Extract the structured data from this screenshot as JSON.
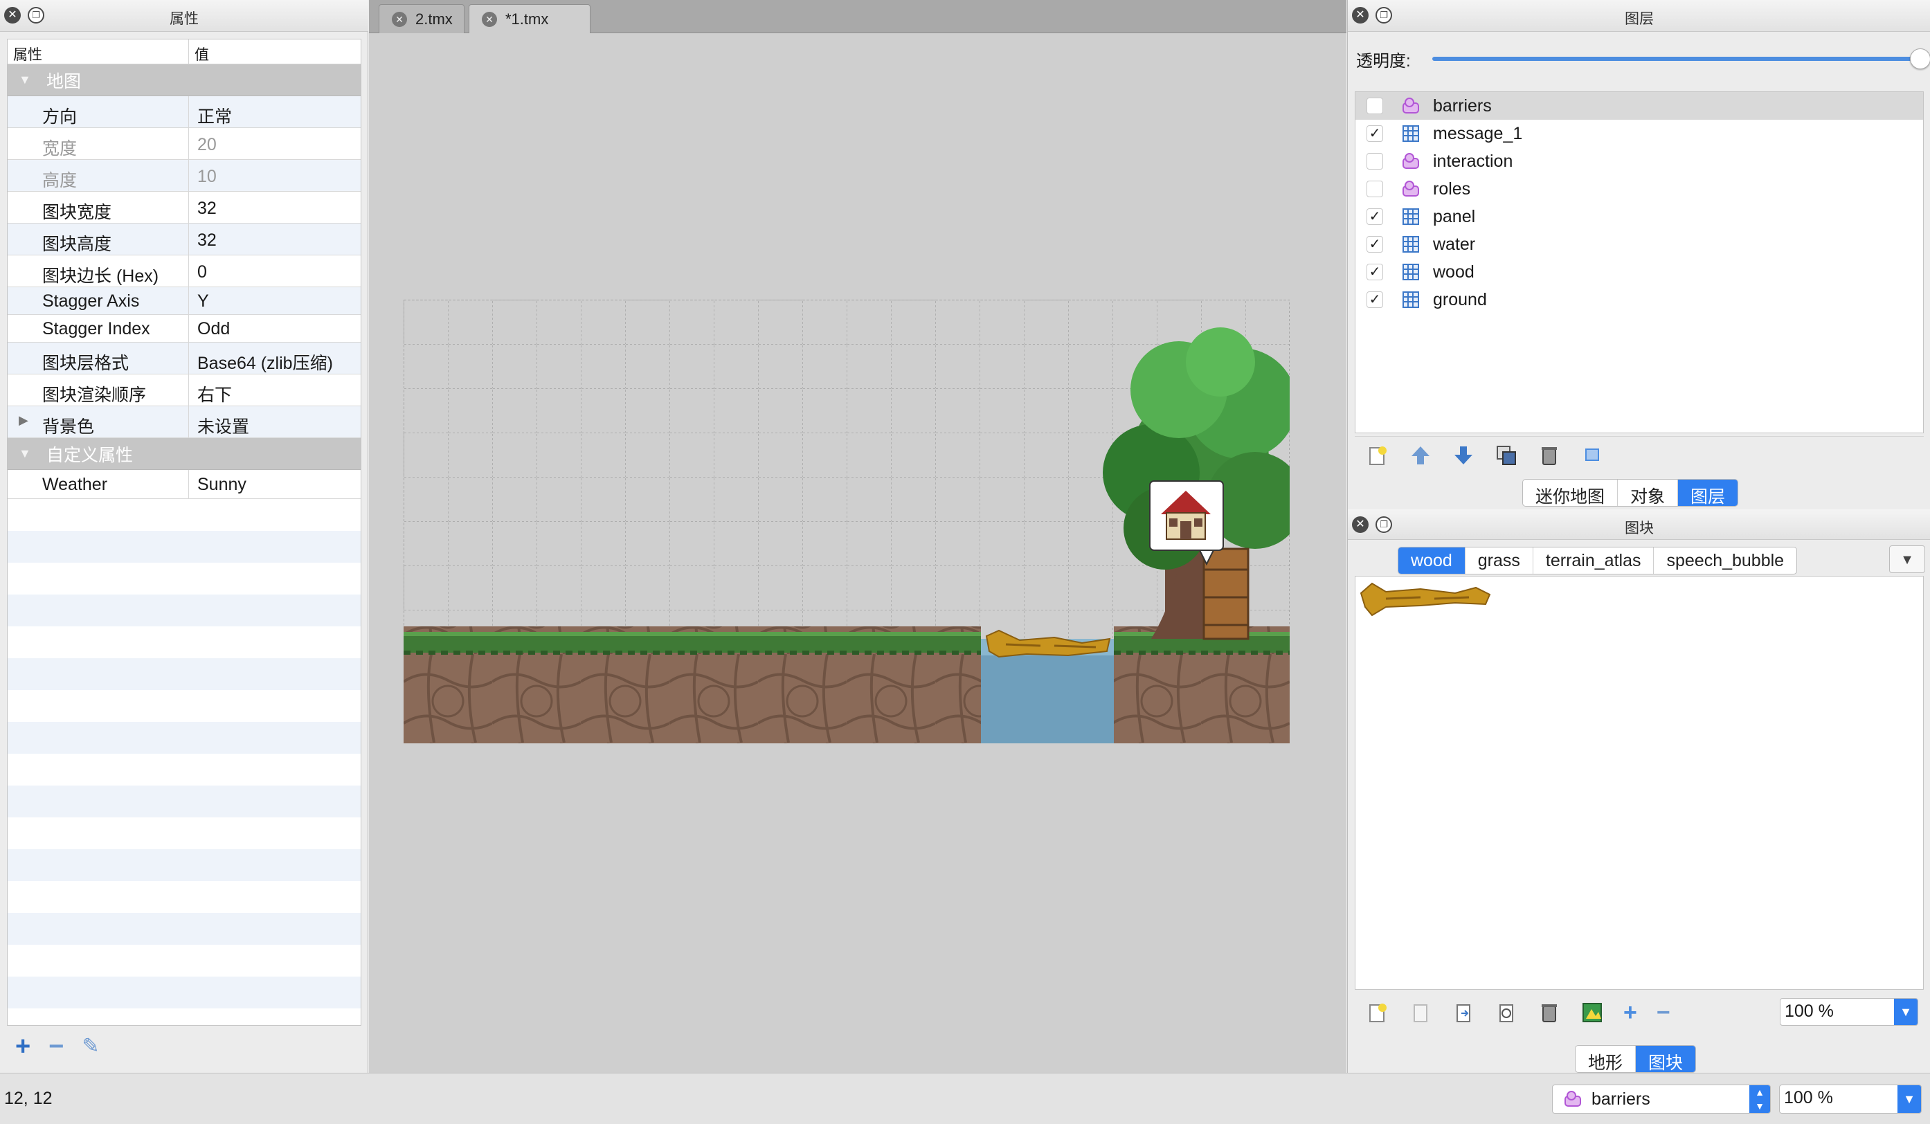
{
  "properties_panel": {
    "title": "属性",
    "columns": {
      "property": "属性",
      "value": "值"
    },
    "group_map": "地图",
    "rows": [
      {
        "key": "方向",
        "value": "正常"
      },
      {
        "key": "宽度",
        "value": "20"
      },
      {
        "key": "高度",
        "value": "10"
      },
      {
        "key": "图块宽度",
        "value": "32"
      },
      {
        "key": "图块高度",
        "value": "32"
      },
      {
        "key": "图块边长 (Hex)",
        "value": "0"
      },
      {
        "key": "Stagger Axis",
        "value": "Y"
      },
      {
        "key": "Stagger Index",
        "value": "Odd"
      },
      {
        "key": "图块层格式",
        "value": "Base64 (zlib压缩)"
      },
      {
        "key": "图块渲染顺序",
        "value": "右下"
      },
      {
        "key": "背景色",
        "value": "未设置"
      }
    ],
    "group_custom": "自定义属性",
    "custom_rows": [
      {
        "key": "Weather",
        "value": "Sunny"
      }
    ]
  },
  "editor": {
    "tabs": [
      {
        "label": "2.tmx"
      },
      {
        "label": "*1.tmx"
      }
    ]
  },
  "layers_panel": {
    "title": "图层",
    "opacity_label": "透明度:",
    "opacity": 1.0,
    "layers": [
      {
        "name": "barriers",
        "type": "object",
        "visible": false
      },
      {
        "name": "message_1",
        "type": "tile",
        "visible": true
      },
      {
        "name": "interaction",
        "type": "object",
        "visible": false
      },
      {
        "name": "roles",
        "type": "object",
        "visible": false
      },
      {
        "name": "panel",
        "type": "tile",
        "visible": true
      },
      {
        "name": "water",
        "type": "tile",
        "visible": true
      },
      {
        "name": "wood",
        "type": "tile",
        "visible": true
      },
      {
        "name": "ground",
        "type": "tile",
        "visible": true
      }
    ],
    "check_mark": "✓",
    "view_tabs": [
      "迷你地图",
      "对象",
      "图层"
    ]
  },
  "tilesets_panel": {
    "title": "图块",
    "tabs": [
      "wood",
      "grass",
      "terrain_atlas",
      "speech_bubble"
    ],
    "zoom": "100 %",
    "bottom_tabs": [
      "地形",
      "图块"
    ]
  },
  "statusbar": {
    "coords": "12, 12",
    "current_layer": "barriers",
    "zoom": "100 %"
  },
  "colors": {
    "accent": "#2f7ff0",
    "object_layer_icon": "#c56de0",
    "tile_layer_icon": "#3c78c8",
    "water": "#6f9fbc",
    "dirt": "#8a6a55",
    "grass": "#3f7a36"
  }
}
